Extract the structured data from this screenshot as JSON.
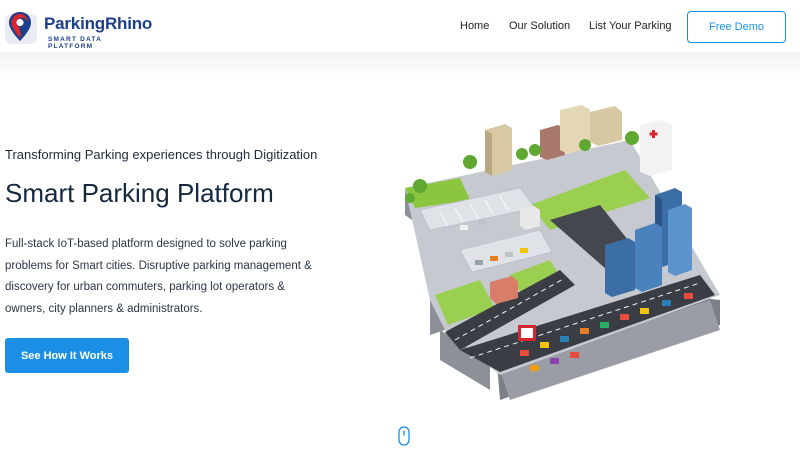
{
  "brand": {
    "name": "ParkingRhino",
    "tagline": "SMART DATA PLATFORM",
    "logo_icon": "map-pin-logo",
    "primary_color": "#1b8fe5",
    "brand_color": "#1c3f8c"
  },
  "nav": {
    "items": [
      {
        "label": "Home"
      },
      {
        "label": "Our Solution"
      },
      {
        "label": "List Your Parking"
      }
    ],
    "demo_label": "Free Demo"
  },
  "hero": {
    "tagline": "Transforming Parking experiences through Digitization",
    "headline": "Smart Parking Platform",
    "description": "Full-stack IoT-based platform designed to solve parking problems for Smart cities. Disruptive parking management & discovery for urban commuters, parking lot operators & owners, city planners & administrators.",
    "cta_label": "See How It Works",
    "illustration_icon": "isometric-smart-city-illustration",
    "scroll_icon": "mouse-scroll-icon"
  }
}
